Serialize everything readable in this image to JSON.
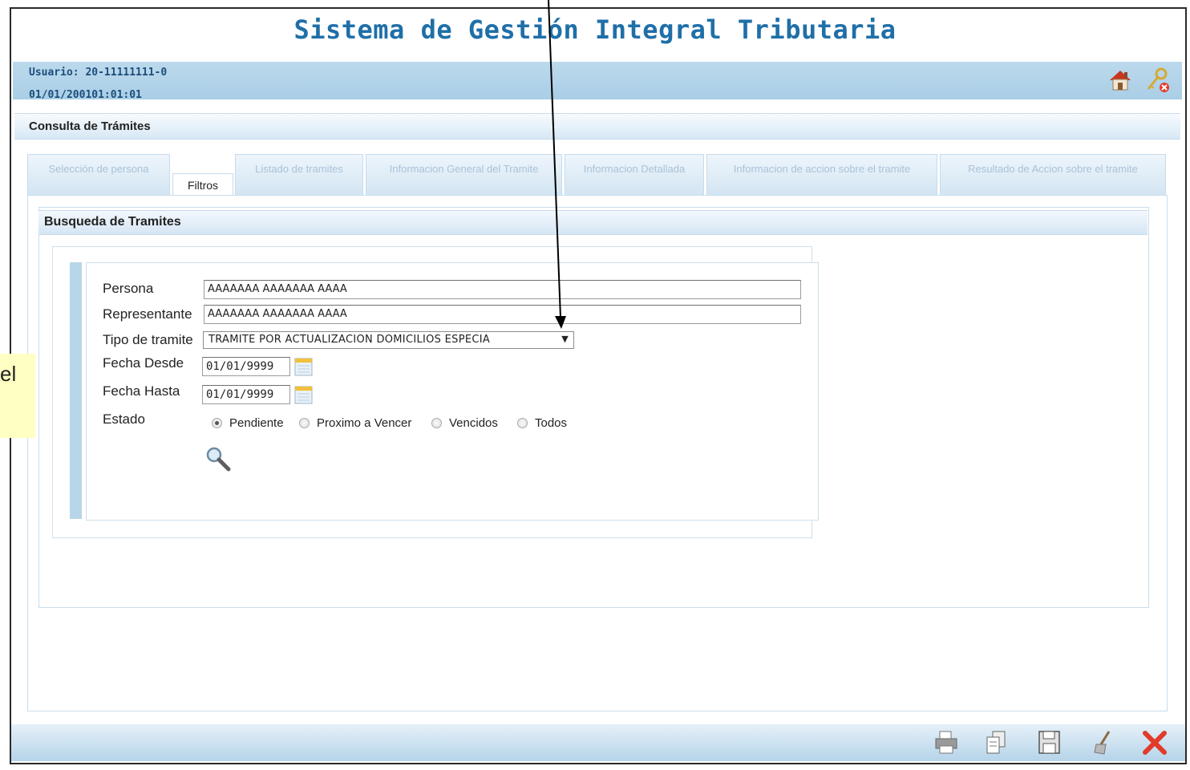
{
  "app": {
    "title": "Sistema de Gestión Integral Tributaria"
  },
  "header": {
    "user_label": "Usuario: 20-11111111-0",
    "datetime": "01/01/200101:01:01",
    "icons": [
      "home-icon",
      "keys-logout-icon"
    ]
  },
  "section": {
    "title": "Consulta de Trámites"
  },
  "tabs": [
    {
      "label": "Selección de persona",
      "active": false
    },
    {
      "label": "Filtros",
      "active": true
    },
    {
      "label": "Listado de tramites",
      "active": false
    },
    {
      "label": "Informacion General del Tramite",
      "active": false
    },
    {
      "label": "Informacion Detallada",
      "active": false
    },
    {
      "label": "Informacion de accion sobre el tramite",
      "active": false
    },
    {
      "label": "Resultado de Accion sobre el tramite",
      "active": false
    }
  ],
  "search_panel": {
    "title": "Busqueda de Tramites",
    "persona_label": "Persona",
    "persona_value": "AAAAAAA AAAAAAA AAAA",
    "representante_label": "Representante",
    "representante_value": "AAAAAAA AAAAAAA AAAA",
    "tipo_label": "Tipo de tramite",
    "tipo_value": "TRAMITE POR ACTUALIZACION DOMICILIOS ESPECIA",
    "fecha_desde_label": "Fecha Desde",
    "fecha_desde_value": "01/01/9999",
    "fecha_hasta_label": "Fecha Hasta",
    "fecha_hasta_value": "01/01/9999",
    "estado_label": "Estado",
    "estado_options": [
      "Pendiente",
      "Proximo a Vencer",
      "Vencidos",
      "Todos"
    ],
    "estado_selected": "Pendiente"
  },
  "bottom_toolbar": {
    "icons": [
      "print-icon",
      "copy-icon",
      "save-icon",
      "clear-broom-icon",
      "close-icon"
    ]
  },
  "annotation": {
    "text": "el"
  },
  "colors": {
    "title": "#1f6fa8",
    "user_bar": "#b1d2e8",
    "close": "#e23b2b"
  }
}
